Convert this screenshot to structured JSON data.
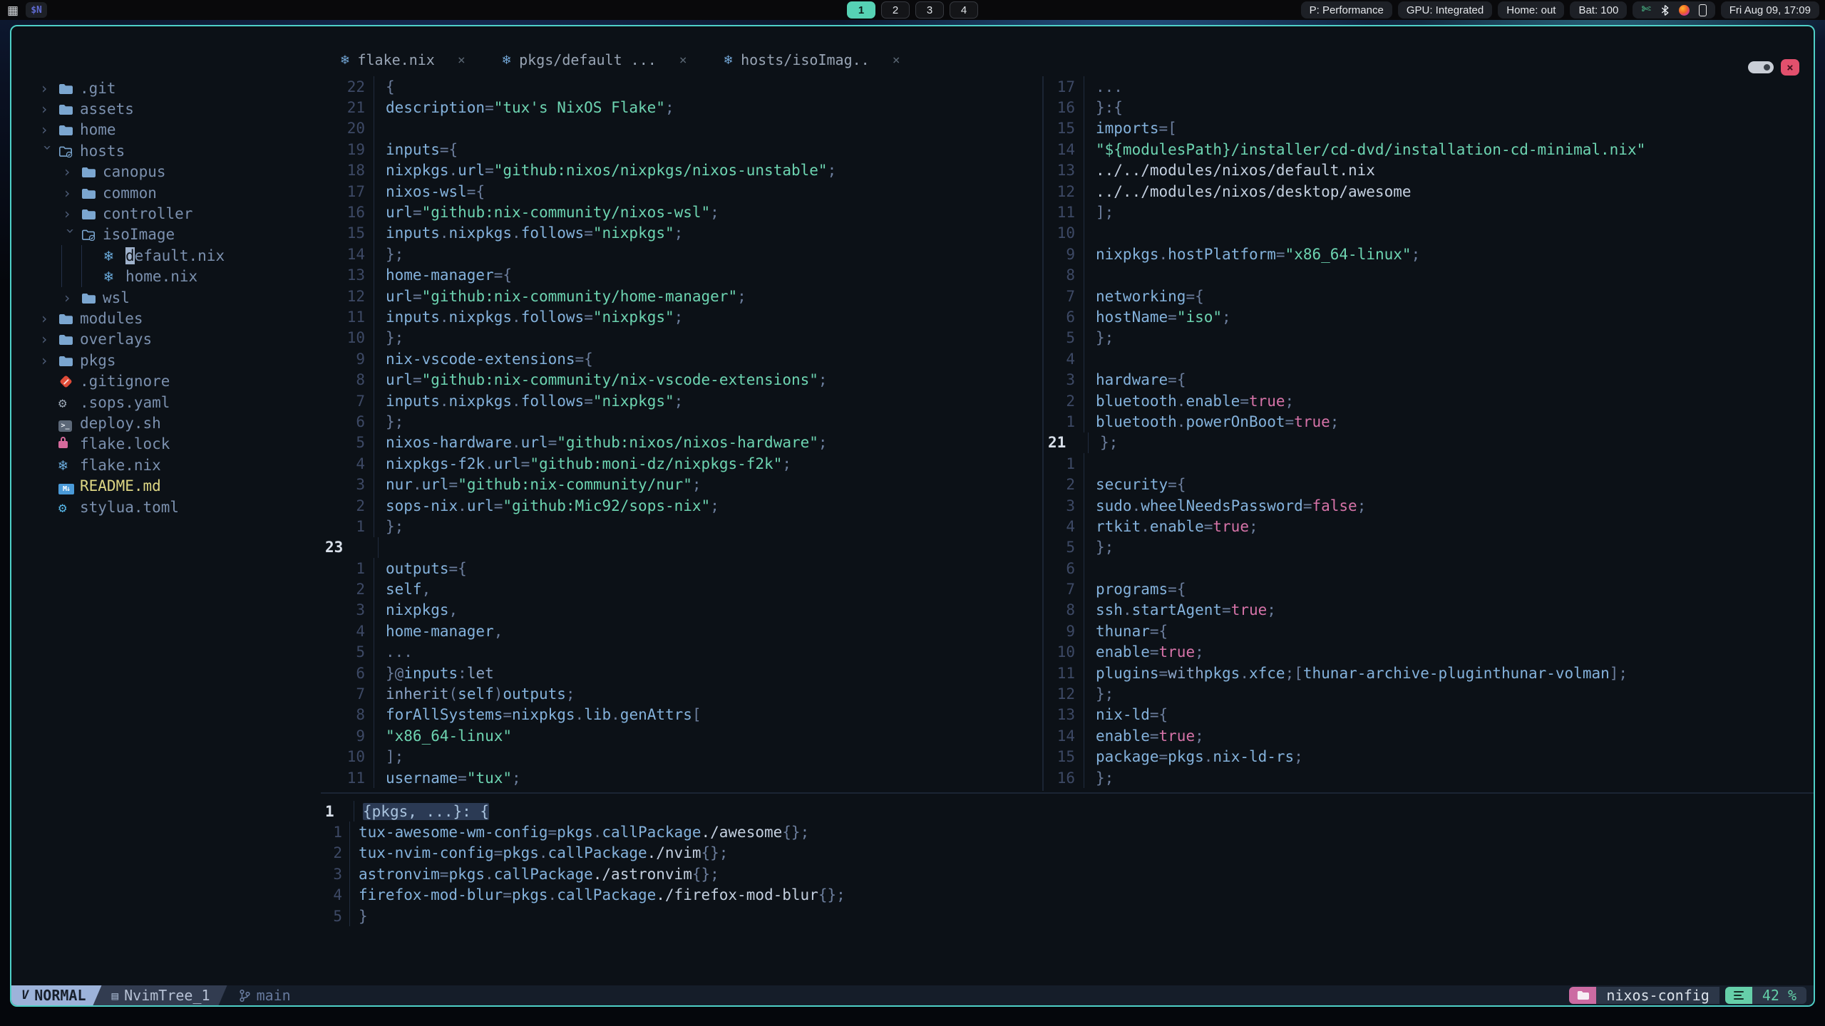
{
  "topbar": {
    "launcher_icon": "grid-icon",
    "app_badge": "$N",
    "workspaces": {
      "items": [
        "1",
        "2",
        "3",
        "4"
      ],
      "active_index": 0
    },
    "status_chips": [
      "P: Performance",
      "GPU: Integrated",
      "Home: out",
      "Bat: 100"
    ],
    "tray_icons": [
      "scissors-icon",
      "bluetooth-icon",
      "firefox-icon",
      "phone-icon"
    ],
    "clock": "Fri Aug 09, 17:09"
  },
  "window": {
    "tabs": [
      {
        "icon": "nix-icon",
        "label": "flake.nix"
      },
      {
        "icon": "nix-icon",
        "label": "pkgs/default ..."
      },
      {
        "icon": "nix-icon",
        "label": "hosts/isoImag.."
      }
    ],
    "tab_close_glyph": "×",
    "controls": {
      "close_glyph": "×"
    }
  },
  "tree": {
    "items": [
      {
        "kind": "dir",
        "state": "closed",
        "level": 0,
        "label": ".git"
      },
      {
        "kind": "dir",
        "state": "closed",
        "level": 0,
        "label": "assets"
      },
      {
        "kind": "dir",
        "state": "closed",
        "level": 0,
        "label": "home"
      },
      {
        "kind": "dir",
        "state": "open",
        "level": 0,
        "label": "hosts"
      },
      {
        "kind": "dir",
        "state": "closed",
        "level": 1,
        "label": "canopus"
      },
      {
        "kind": "dir",
        "state": "closed",
        "level": 1,
        "label": "common"
      },
      {
        "kind": "dir",
        "state": "closed",
        "level": 1,
        "label": "controller"
      },
      {
        "kind": "dir",
        "state": "open",
        "level": 1,
        "label": "isoImage"
      },
      {
        "kind": "file",
        "icon": "nix",
        "level": 2,
        "label": "default.nix",
        "cursor": true,
        "guides": true
      },
      {
        "kind": "file",
        "icon": "nix",
        "level": 2,
        "label": "home.nix",
        "guides": true
      },
      {
        "kind": "dir",
        "state": "closed",
        "level": 1,
        "label": "wsl"
      },
      {
        "kind": "dir",
        "state": "closed",
        "level": 0,
        "label": "modules"
      },
      {
        "kind": "dir",
        "state": "closed",
        "level": 0,
        "label": "overlays"
      },
      {
        "kind": "dir",
        "state": "closed",
        "level": 0,
        "label": "pkgs"
      },
      {
        "kind": "file",
        "icon": "git",
        "level": 0,
        "label": ".gitignore"
      },
      {
        "kind": "file",
        "icon": "gear-gray",
        "level": 0,
        "label": ".sops.yaml"
      },
      {
        "kind": "file",
        "icon": "terminal",
        "level": 0,
        "label": "deploy.sh"
      },
      {
        "kind": "file",
        "icon": "lock",
        "level": 0,
        "label": "flake.lock"
      },
      {
        "kind": "file",
        "icon": "nix",
        "level": 0,
        "label": "flake.nix"
      },
      {
        "kind": "file",
        "icon": "markdown",
        "level": 0,
        "label": "README.md",
        "label_color": "#ddd684"
      },
      {
        "kind": "file",
        "icon": "gear-blue",
        "level": 0,
        "label": "stylua.toml"
      }
    ]
  },
  "panes": {
    "flake": {
      "lines": [
        {
          "n": "22",
          "t": "{"
        },
        {
          "n": "21",
          "t": "  description = \"tux's NixOS Flake\";"
        },
        {
          "n": "20",
          "t": ""
        },
        {
          "n": "19",
          "t": "  inputs = {"
        },
        {
          "n": "18",
          "t": "    nixpkgs.url = \"github:nixos/nixpkgs/nixos-unstable\";"
        },
        {
          "n": "17",
          "t": "    nixos-wsl = {"
        },
        {
          "n": "16",
          "t": "      url = \"github:nix-community/nixos-wsl\";"
        },
        {
          "n": "15",
          "t": "      inputs.nixpkgs.follows = \"nixpkgs\";"
        },
        {
          "n": "14",
          "t": "    };"
        },
        {
          "n": "13",
          "t": "    home-manager = {"
        },
        {
          "n": "12",
          "t": "      url = \"github:nix-community/home-manager\";"
        },
        {
          "n": "11",
          "t": "      inputs.nixpkgs.follows = \"nixpkgs\";"
        },
        {
          "n": "10",
          "t": "    };"
        },
        {
          "n": "9",
          "t": "    nix-vscode-extensions = {"
        },
        {
          "n": "8",
          "t": "      url = \"github:nix-community/nix-vscode-extensions\";"
        },
        {
          "n": "7",
          "t": "      inputs.nixpkgs.follows = \"nixpkgs\";"
        },
        {
          "n": "6",
          "t": "    };"
        },
        {
          "n": "5",
          "t": "    nixos-hardware.url = \"github:nixos/nixos-hardware\";"
        },
        {
          "n": "4",
          "t": "    nixpkgs-f2k.url = \"github:moni-dz/nixpkgs-f2k\";"
        },
        {
          "n": "3",
          "t": "    nur.url = \"github:nix-community/nur\";"
        },
        {
          "n": "2",
          "t": "    sops-nix.url = \"github:Mic92/sops-nix\";"
        },
        {
          "n": "1",
          "t": "  };"
        },
        {
          "n": "23",
          "t": "",
          "c": true
        },
        {
          "n": "1",
          "t": "  outputs = {"
        },
        {
          "n": "2",
          "t": "    self,"
        },
        {
          "n": "3",
          "t": "    nixpkgs,"
        },
        {
          "n": "4",
          "t": "    home-manager,"
        },
        {
          "n": "5",
          "t": "    ..."
        },
        {
          "n": "6",
          "t": "  } @ inputs: let"
        },
        {
          "n": "7",
          "t": "    inherit (self) outputs;"
        },
        {
          "n": "8",
          "t": "    forAllSystems = nixpkgs.lib.genAttrs ["
        },
        {
          "n": "9",
          "t": "      \"x86_64-linux\""
        },
        {
          "n": "10",
          "t": "    ];"
        },
        {
          "n": "11",
          "t": "    username = \"tux\";"
        }
      ]
    },
    "iso": {
      "lines": [
        {
          "n": "17",
          "t": "  ..."
        },
        {
          "n": "16",
          "t": "}: {"
        },
        {
          "n": "15",
          "t": "  imports = ["
        },
        {
          "n": "14",
          "t": "    \"${modulesPath}/installer/cd-dvd/installation-cd-minimal.nix\""
        },
        {
          "n": "13",
          "t": "    ../../modules/nixos/default.nix"
        },
        {
          "n": "12",
          "t": "    ../../modules/nixos/desktop/awesome"
        },
        {
          "n": "11",
          "t": "  ];"
        },
        {
          "n": "10",
          "t": ""
        },
        {
          "n": "9",
          "t": "  nixpkgs.hostPlatform = \"x86_64-linux\";"
        },
        {
          "n": "8",
          "t": ""
        },
        {
          "n": "7",
          "t": "  networking = {"
        },
        {
          "n": "6",
          "t": "    hostName = \"iso\";"
        },
        {
          "n": "5",
          "t": "  };"
        },
        {
          "n": "4",
          "t": ""
        },
        {
          "n": "3",
          "t": "  hardware = {"
        },
        {
          "n": "2",
          "t": "    bluetooth.enable = true;"
        },
        {
          "n": "1",
          "t": "    bluetooth.powerOnBoot = true;"
        },
        {
          "n": "21",
          "t": "  };",
          "c": true
        },
        {
          "n": "1",
          "t": ""
        },
        {
          "n": "2",
          "t": "  security = {"
        },
        {
          "n": "3",
          "t": "    sudo.wheelNeedsPassword = false;"
        },
        {
          "n": "4",
          "t": "    rtkit.enable = true;"
        },
        {
          "n": "5",
          "t": "  };"
        },
        {
          "n": "6",
          "t": ""
        },
        {
          "n": "7",
          "t": "  programs = {"
        },
        {
          "n": "8",
          "t": "    ssh.startAgent = true;"
        },
        {
          "n": "9",
          "t": "    thunar = {"
        },
        {
          "n": "10",
          "t": "      enable = true;"
        },
        {
          "n": "11",
          "t": "      plugins = with pkgs.xfce; [thunar-archive-plugin thunar-volman];"
        },
        {
          "n": "12",
          "t": "    };"
        },
        {
          "n": "13",
          "t": "    nix-ld = {"
        },
        {
          "n": "14",
          "t": "      enable = true;"
        },
        {
          "n": "15",
          "t": "      package = pkgs.nix-ld-rs;"
        },
        {
          "n": "16",
          "t": "    };"
        }
      ]
    },
    "pkgs": {
      "lines": [
        {
          "n": "1",
          "t": "{pkgs, ...}: {",
          "c": true,
          "sel": true
        },
        {
          "n": "1",
          "t": "  tux-awesome-wm-config = pkgs.callPackage ./awesome {};"
        },
        {
          "n": "2",
          "t": "  tux-nvim-config = pkgs.callPackage ./nvim {};"
        },
        {
          "n": "3",
          "t": "  astronvim = pkgs.callPackage ./astronvim {};"
        },
        {
          "n": "4",
          "t": "  firefox-mod-blur = pkgs.callPackage ./firefox-mod-blur {};"
        },
        {
          "n": "5",
          "t": "}"
        }
      ]
    }
  },
  "statusline": {
    "mode": "NORMAL",
    "buffer": "NvimTree_1",
    "branch": "main",
    "project": "nixos-config",
    "scroll": "42 %"
  },
  "colors": {
    "window_border": "#4fd0c7",
    "editor_bg": "#0c1117",
    "string": "#6dd4b1",
    "boolean": "#d673a8",
    "identifier": "#84b2dc",
    "mode_segment": "#9db3da",
    "project_segment": "#cc6ba2",
    "scroll_segment": "#66cfa9",
    "workspace_active": "#56d2b4"
  }
}
